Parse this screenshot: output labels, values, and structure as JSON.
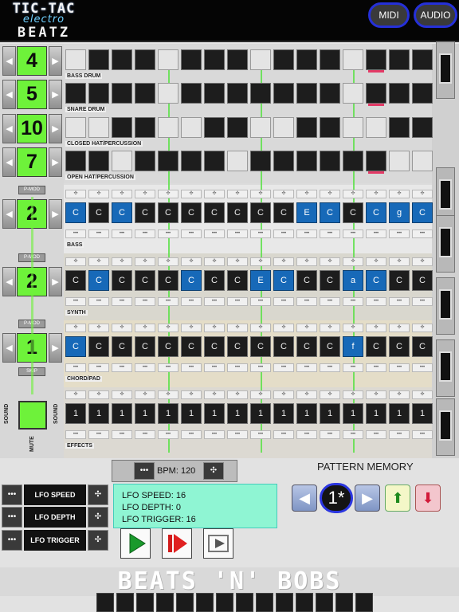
{
  "app": {
    "logo_line1": "TIC-TAC",
    "logo_line2": "electro",
    "logo_line3": "BEATZ",
    "midi_label": "MIDI",
    "audio_label": "AUDIO"
  },
  "drum_tracks": [
    {
      "name": "BASS DRUM",
      "count": "4",
      "steps": [
        1,
        0,
        0,
        0,
        1,
        0,
        0,
        0,
        1,
        0,
        0,
        0,
        1,
        0,
        0,
        0
      ],
      "marks": [
        13
      ]
    },
    {
      "name": "SNARE DRUM",
      "count": "5",
      "steps": [
        0,
        0,
        0,
        0,
        1,
        0,
        0,
        0,
        0,
        0,
        0,
        0,
        1,
        0,
        0,
        0
      ],
      "marks": [
        13
      ]
    },
    {
      "name": "CLOSED HAT/PERCUSSION",
      "count": "10",
      "steps": [
        1,
        1,
        0,
        0,
        1,
        1,
        0,
        0,
        1,
        1,
        0,
        0,
        1,
        1,
        0,
        0
      ],
      "marks": []
    },
    {
      "name": "OPEN HAT/PERCUSSION",
      "count": "7",
      "steps": [
        0,
        0,
        1,
        0,
        0,
        0,
        0,
        1,
        0,
        0,
        0,
        0,
        0,
        0,
        1,
        1
      ],
      "marks": [
        13
      ]
    }
  ],
  "note_tracks": [
    {
      "name": "BASS",
      "count": "2",
      "notes": [
        "C",
        "C",
        "C",
        "C",
        "C",
        "C",
        "C",
        "C",
        "C",
        "C",
        "E",
        "C",
        "C",
        "C",
        "g",
        "C"
      ],
      "blue": [
        0,
        2,
        10,
        11,
        13,
        14,
        15
      ],
      "marks": [
        13
      ]
    },
    {
      "name": "SYNTH",
      "count": "2",
      "notes": [
        "C",
        "C",
        "C",
        "C",
        "C",
        "C",
        "C",
        "C",
        "E",
        "C",
        "C",
        "C",
        "a",
        "C",
        "C",
        "C"
      ],
      "blue": [
        1,
        5,
        8,
        9,
        12,
        13
      ],
      "marks": [
        13
      ]
    },
    {
      "name": "CHORD/PAD",
      "count": "1",
      "notes": [
        "C",
        "C",
        "C",
        "C",
        "C",
        "C",
        "C",
        "C",
        "C",
        "C",
        "C",
        "C",
        "f",
        "C",
        "C",
        "C"
      ],
      "blue": [
        0,
        12
      ],
      "marks": [
        11
      ]
    },
    {
      "name": "EFFECTS",
      "count": "",
      "notes": [
        "1",
        "1",
        "1",
        "1",
        "1",
        "1",
        "1",
        "1",
        "1",
        "1",
        "1",
        "1",
        "1",
        "1",
        "1",
        "1"
      ],
      "blue": [],
      "marks": [
        13
      ]
    }
  ],
  "side": {
    "pmod_label": "P-MOD",
    "skip_label": "SKIP",
    "sound_label": "SOUND",
    "mute_label": "MUTE"
  },
  "controls": {
    "minus_glyph": "•••",
    "plus_glyph": "✣",
    "left_arrow": "◀",
    "right_arrow": "▶"
  },
  "bpm": {
    "label": "BPM: 120"
  },
  "lfo": {
    "speed_label": "LFO SPEED",
    "depth_label": "LFO DEPTH",
    "trigger_label": "LFO TRIGGER",
    "speed_value": "LFO SPEED: 16",
    "depth_value": "LFO DEPTH: 0",
    "trigger_value": "LFO TRIGGER: 16"
  },
  "pattern_memory": {
    "title": "PATTERN MEMORY",
    "current": "1*",
    "load_glyph": "⬆",
    "save_glyph": "⬇"
  },
  "brand": {
    "text": "BEATS 'N' BOBS"
  },
  "colors": {
    "accent_green": "#6ef23a",
    "step_blue": "#1769b8",
    "marker_pink": "#e33a66",
    "lfo_panel": "#8ff5d3",
    "ring_blue": "#2b36e0"
  }
}
